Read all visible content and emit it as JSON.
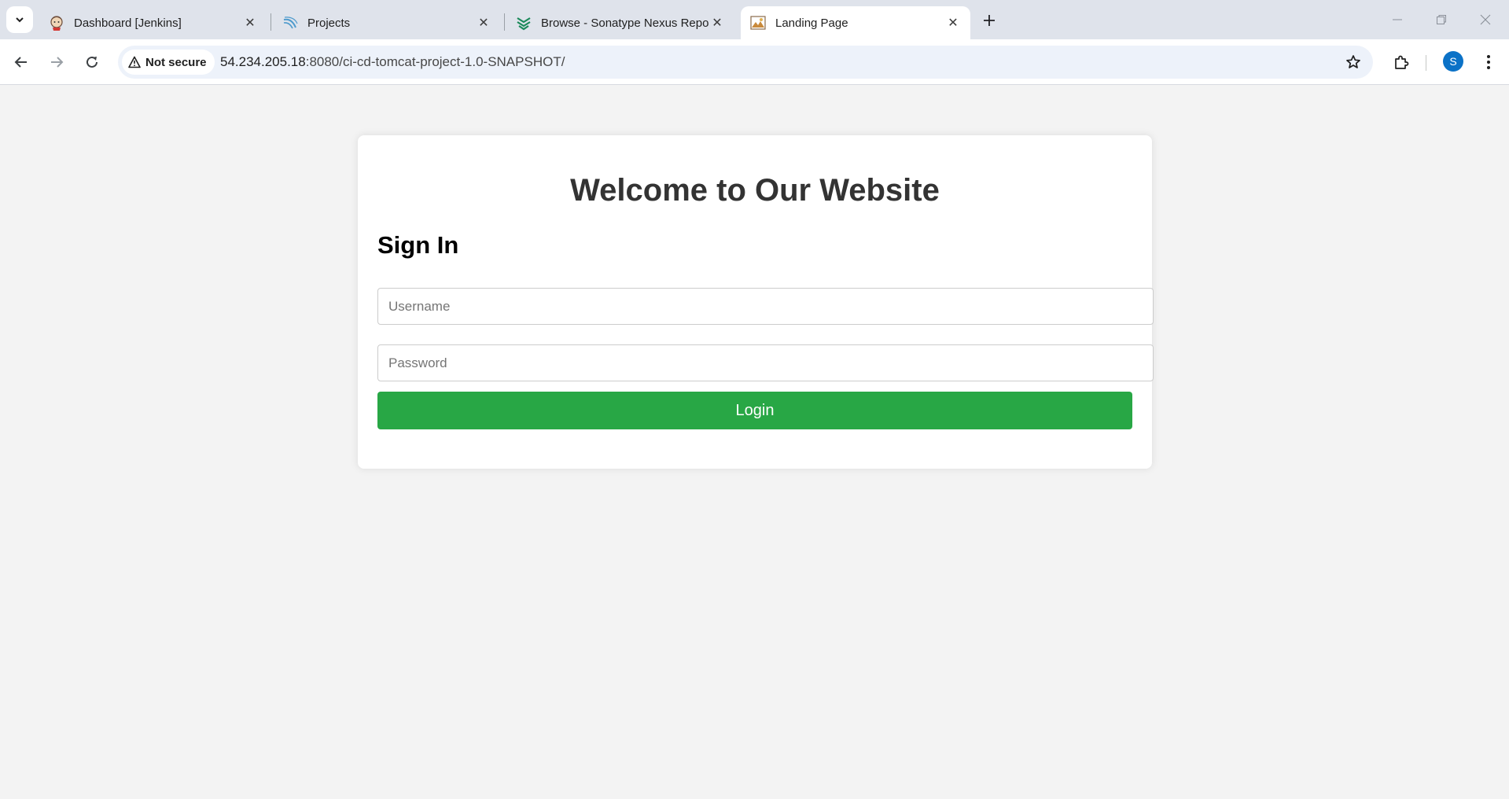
{
  "browser": {
    "tabs": [
      {
        "title": "Dashboard [Jenkins]",
        "icon": "jenkins-icon"
      },
      {
        "title": "Projects",
        "icon": "sonarqube-icon"
      },
      {
        "title": "Browse - Sonatype Nexus Repository",
        "icon": "nexus-icon"
      },
      {
        "title": "Landing Page",
        "icon": "landing-page-icon",
        "active": true
      }
    ],
    "address_bar": {
      "security_label": "Not secure",
      "url_host": "54.234.205.18",
      "url_path": ":8080/ci-cd-tomcat-project-1.0-SNAPSHOT/"
    },
    "profile_initial": "S"
  },
  "page": {
    "welcome_title": "Welcome to Our Website",
    "signin_heading": "Sign In",
    "username_placeholder": "Username",
    "password_placeholder": "Password",
    "login_label": "Login"
  },
  "colors": {
    "login_button": "#28a745",
    "page_background": "#f3f3f3",
    "avatar": "#0b72c7"
  }
}
